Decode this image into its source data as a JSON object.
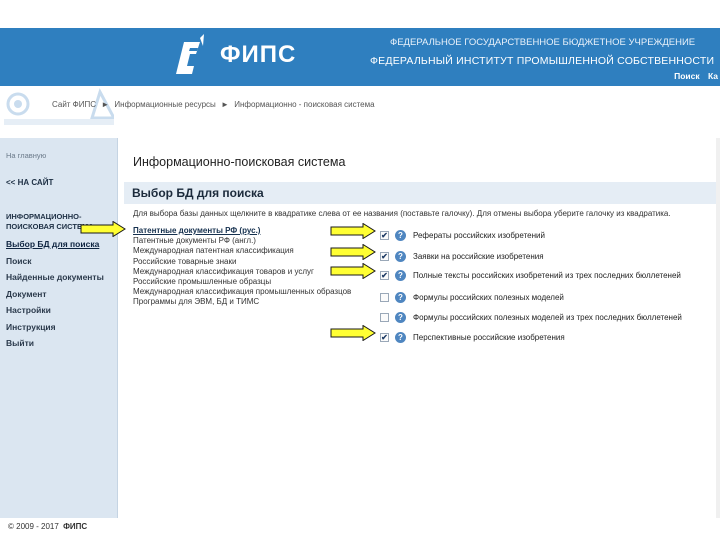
{
  "header": {
    "brand": "ФИПС",
    "org_line1": "ФЕДЕРАЛЬНОЕ ГОСУДАРСТВЕННОЕ БЮДЖЕТНОЕ УЧРЕЖДЕНИЕ",
    "org_line2": "ФЕДЕРАЛЬНЫЙ ИНСТИТУТ ПРОМЫШЛЕННОЙ СОБСТВЕННОСТИ",
    "links": [
      "Поиск",
      "Ка"
    ]
  },
  "breadcrumb": [
    "Сайт ФИПС",
    "►",
    "Информационные ресурсы",
    "►",
    "Информационно - поисковая система"
  ],
  "sidebar": {
    "home_label": "На главную",
    "back_label": "<< НА САЙТ",
    "section_title": "ИНФОРМАЦИОННО-ПОИСКОВАЯ СИСТЕМА",
    "menu": [
      {
        "label": "Выбор БД для поиска",
        "active": true
      },
      {
        "label": "Поиск"
      },
      {
        "label": "Найденные документы"
      },
      {
        "label": "Документ"
      },
      {
        "label": "Настройки"
      },
      {
        "label": "Инструкция"
      },
      {
        "label": "Выйти"
      }
    ]
  },
  "main": {
    "system_title": "Информационно-поисковая система",
    "section_title": "Выбор БД для поиска",
    "instruction": "Для выбора базы данных щелкните в квадратике слева от ее названия (поставьте галочку). Для отмены выбора уберите галочку из квадратика.",
    "categories": [
      {
        "label": "Патентные документы РФ (рус.)",
        "selected": true
      },
      {
        "label": "Патентные документы РФ (англ.)"
      },
      {
        "label": "Международная патентная классификация"
      },
      {
        "label": "Российские товарные знаки"
      },
      {
        "label": "Международная классификация товаров и услуг"
      },
      {
        "label": "Российские промышленные образцы"
      },
      {
        "label": "Международная классификация промышленных образцов"
      },
      {
        "label": "Программы для ЭВМ, БД и ТИМС"
      }
    ],
    "databases": [
      {
        "label": "Рефераты российских изобретений",
        "checked": true
      },
      {
        "label": "Заявки на российские изобретения",
        "checked": true
      },
      {
        "label": "Полные тексты российских изобретений из трех последних бюллетеней",
        "checked": true
      },
      {
        "label": "Формулы российских полезных моделей",
        "checked": false
      },
      {
        "label": "Формулы российских полезных моделей из трех последних бюллетеней",
        "checked": false
      },
      {
        "label": "Перспективные российские изобретения",
        "checked": true
      }
    ],
    "help_glyph": "?",
    "check_glyph": "✔"
  },
  "footer": {
    "copyright": "© 2009 - 2017",
    "brand": "ФИПС"
  },
  "colors": {
    "header_bg": "#2f7fbf",
    "sidebar_bg": "#dbe6f1",
    "arrow_fill": "#ffff33",
    "arrow_stroke": "#1a1a1a",
    "help_icon": "#4f86c0"
  }
}
